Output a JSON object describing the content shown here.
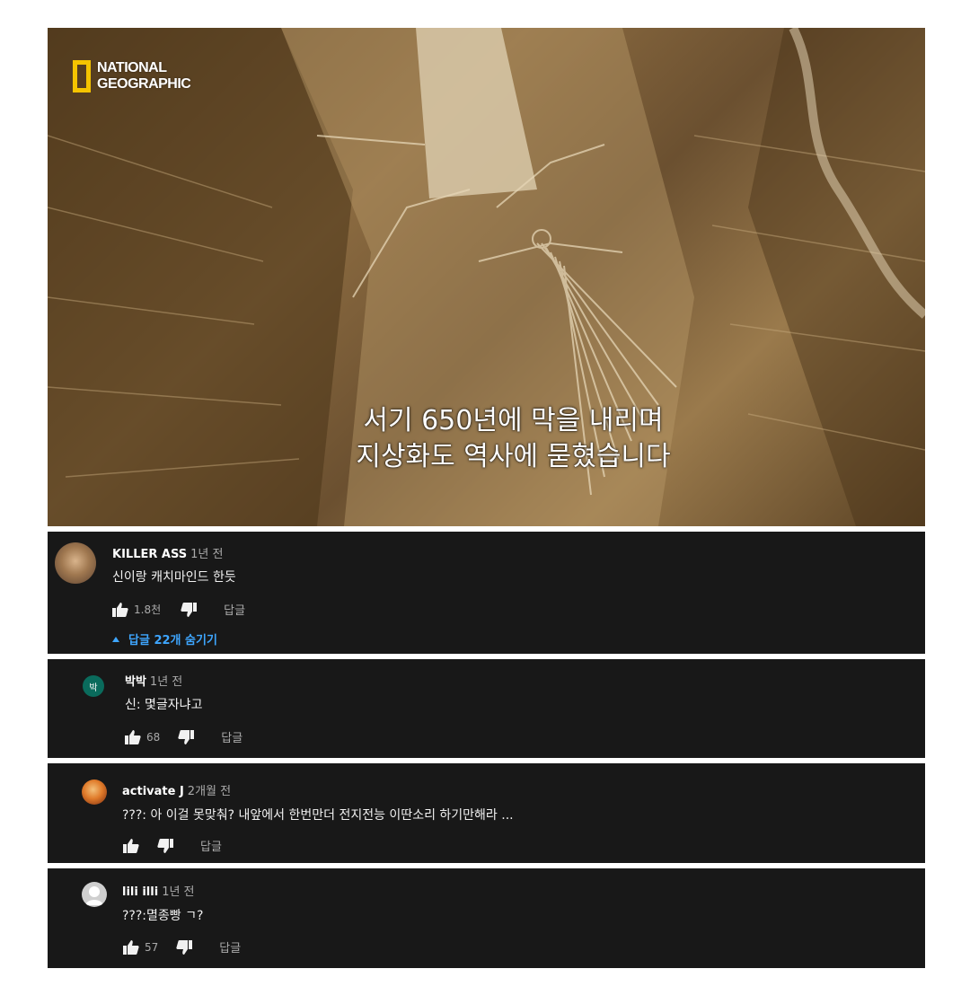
{
  "video": {
    "logo_line1": "NATIONAL",
    "logo_line2": "GEOGRAPHIC",
    "subtitle_line1": "서기 650년에 막을 내리며",
    "subtitle_line2": "지상화도 역사에 묻혔습니다",
    "logo_color": "#f5c400"
  },
  "comments": [
    {
      "author": "KILLER ASS",
      "time": "1년 전",
      "text": "신이랑 캐치마인드 한듯",
      "likes": "1.8천",
      "reply_label": "답글",
      "replies_toggle": "답글 22개 숨기기",
      "avatar_icon": "user-avatar-photo"
    },
    {
      "author": "박박",
      "time": "1년 전",
      "text": "신: 몇글자냐고",
      "likes": "68",
      "reply_label": "답글",
      "avatar_letter": "박",
      "avatar_color": "#0a6b5c"
    },
    {
      "author": "activate J",
      "time": "2개월 전",
      "text": "???: 아 이걸 못맞춰? 내앞에서 한번만더 전지전능 이딴소리 하기만해라 ...",
      "likes": "",
      "reply_label": "답글",
      "avatar_icon": "cartoon-avatar"
    },
    {
      "author": "lili illi",
      "time": "1년 전",
      "text": "???:멸종빵 ㄱ?",
      "likes": "57",
      "reply_label": "답글",
      "avatar_icon": "default-user-avatar"
    }
  ],
  "colors": {
    "comment_bg": "#181818",
    "link_blue": "#3ea6ff",
    "muted_text": "#aaaaaa"
  }
}
